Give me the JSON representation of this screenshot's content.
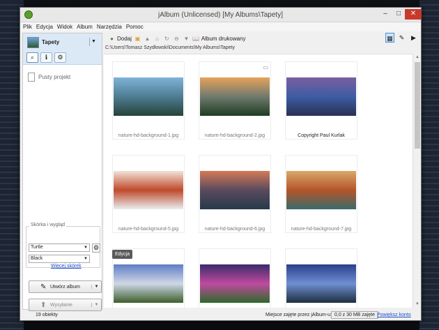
{
  "window": {
    "title": "jAlbum (Unlicensed) [My Albums\\Tapety]",
    "btn_min": "–",
    "btn_max": "□",
    "btn_close": "✕"
  },
  "menu": [
    "Plik",
    "Edycja",
    "Widok",
    "Album",
    "Narzędzia",
    "Pomoc"
  ],
  "sidebar": {
    "album_name": "Tapety",
    "project_label": "Pusty projekt",
    "skin_section_label": "Skórka i wygląd",
    "skin_value": "Turtle",
    "style_value": "Black",
    "more_skins": "Więcej skórek",
    "create_album": "Utwórz album",
    "upload": "Wysyłanie"
  },
  "toolbar": {
    "add": "Dodaj",
    "print_album": "Album drukowany"
  },
  "path": "C:\\Users\\Tomasz Szydłowski\\Documents\\My Albums\\Tapety",
  "images": [
    {
      "caption": "nature-hd-background-1.jpg",
      "colors": [
        "#7fb2d8",
        "#4e7d92",
        "#26423a"
      ]
    },
    {
      "caption": "nature-hd-background-2.jpg",
      "colors": [
        "#e7a25b",
        "#6f7a6e",
        "#1f3c22"
      ]
    },
    {
      "caption": "Copyright Paul Kurlak",
      "colors": [
        "#7a5ea0",
        "#3d5da3",
        "#2a2f55"
      ]
    },
    {
      "caption": "nature-hd-background-5.jpg",
      "colors": [
        "#f1e2d8",
        "#c04a2a",
        "#e9eef2"
      ]
    },
    {
      "caption": "nature-hd-background-6.jpg",
      "colors": [
        "#d47a55",
        "#5a4a5e",
        "#253a4a"
      ]
    },
    {
      "caption": "nature-hd-background-7.jpg",
      "colors": [
        "#d9a86a",
        "#b5552a",
        "#3a6a6a"
      ]
    },
    {
      "caption": "",
      "colors": [
        "#5e7ec4",
        "#cfd7e6",
        "#3d5f2c"
      ]
    },
    {
      "caption": "",
      "colors": [
        "#3a2b6a",
        "#c04aa0",
        "#2d6a2a"
      ]
    },
    {
      "caption": "",
      "colors": [
        "#2a3f8a",
        "#6f8fd2",
        "#1e2e3e"
      ]
    }
  ],
  "edit_badge": "Edycja",
  "status": {
    "count": "19 obiekty",
    "space_label": "Miejsce zajęte przez jAlbum-u:",
    "space_used": "0,0 z 30 MB zajęte",
    "upgrade_link": "Powiększ konto"
  }
}
